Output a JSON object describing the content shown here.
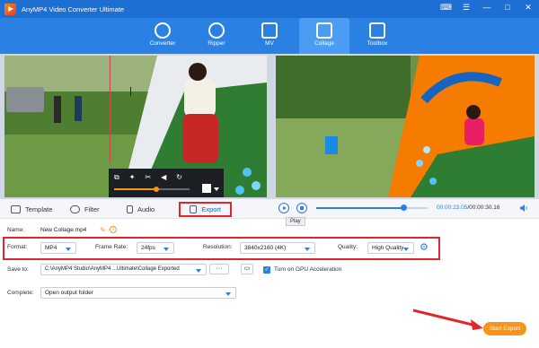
{
  "app": {
    "title": "AnyMP4 Video Converter Ultimate"
  },
  "window_buttons": [
    "⌨",
    "☰",
    "—",
    "□",
    "✕"
  ],
  "nav": [
    {
      "label": "Converter",
      "icon": "refresh-icon",
      "active": false
    },
    {
      "label": "Ripper",
      "icon": "disc-icon",
      "active": false
    },
    {
      "label": "MV",
      "icon": "tv-icon",
      "active": false
    },
    {
      "label": "Collage",
      "icon": "collage-icon",
      "active": true
    },
    {
      "label": "Toolbox",
      "icon": "toolbox-icon",
      "active": false
    }
  ],
  "tabs": [
    {
      "label": "Template",
      "icon": "template-icon"
    },
    {
      "label": "Filter",
      "icon": "cloud-icon"
    },
    {
      "label": "Audio",
      "icon": "speaker-icon"
    },
    {
      "label": "Export",
      "icon": "export-icon"
    }
  ],
  "player": {
    "tooltip": "Play",
    "time_current": "00:00:23.05",
    "time_total": "/00:00:30.16",
    "progress": 0.78
  },
  "export": {
    "name_label": "Name:",
    "name_value": "New Collage.mp4",
    "format_label": "Format:",
    "format_value": "MP4",
    "framerate_label": "Frame Rate:",
    "framerate_value": "24fps",
    "resolution_label": "Resolution:",
    "resolution_value": "3840x2160 (4K)",
    "quality_label": "Quality:",
    "quality_value": "High Quality",
    "saveto_label": "Save to:",
    "saveto_value": "C:\\AnyMP4 Studio\\AnyMP4 ...Ultimate\\Collage Exported",
    "browse_label": "···",
    "gpu_label": "Turn on GPU Acceleration",
    "complete_label": "Complete:",
    "complete_value": "Open output folder",
    "start_label": "Start Export"
  },
  "colors": {
    "titlebar": "#1e6fd3",
    "nav": "#2b80e4",
    "highlight": "#e0262a",
    "start": "#f7941d"
  }
}
